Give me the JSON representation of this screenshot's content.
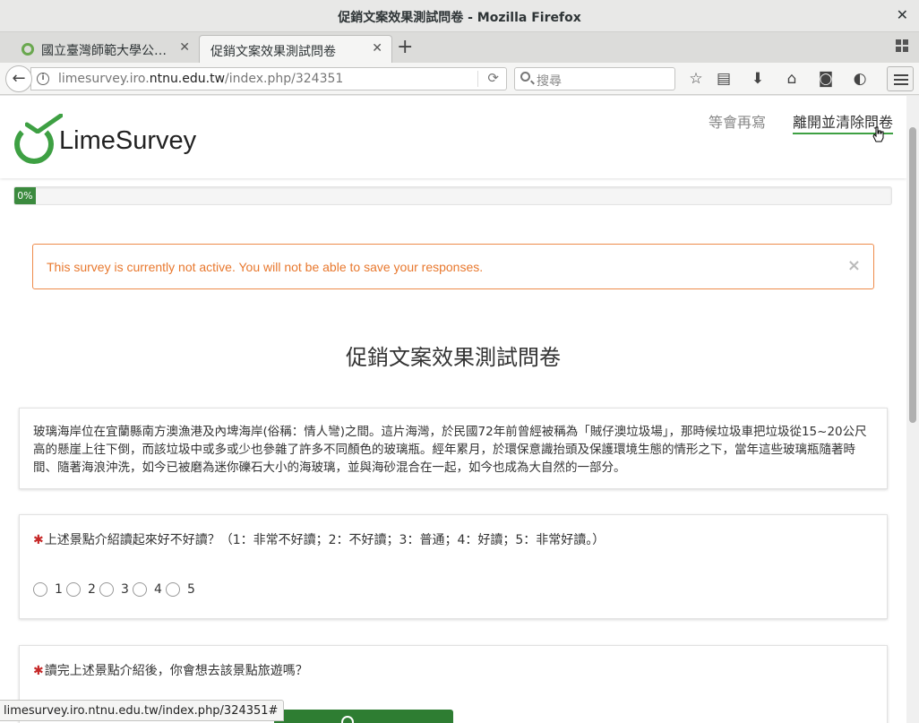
{
  "window": {
    "title": "促銷文案效果測試問卷 - Mozilla Firefox"
  },
  "tabs": [
    {
      "label": "國立臺灣師範大學公…"
    },
    {
      "label": "促銷文案效果測試問卷"
    }
  ],
  "navbar": {
    "url_prefix": "limesurvey.iro.",
    "url_domain": "ntnu.edu.tw",
    "url_suffix": "/index.php/324351",
    "search_placeholder": "搜尋"
  },
  "header": {
    "logo_text": "LimeSurvey",
    "resume_later": "等會再寫",
    "exit_clear": "離開並清除問卷"
  },
  "progress": {
    "label": "0%",
    "value": 0
  },
  "alert": {
    "message": "This survey is currently not active. You will not be able to save your responses."
  },
  "survey": {
    "title": "促銷文案效果測試問卷",
    "intro": "玻璃海岸位在宜蘭縣南方澳漁港及內埤海岸(俗稱：情人彎)之間。這片海灣，於民國72年前曾經被稱為「賊仔澳垃圾場」，那時候垃圾車把垃圾從15~20公尺高的懸崖上往下倒，而該垃圾中或多或少也參雜了許多不同顏色的玻璃瓶。經年累月，於環保意識抬頭及保護環境生態的情形之下，當年這些玻璃瓶隨著時間、隨著海浪沖洗，如今已被磨為迷你礫石大小的海玻璃，並與海砂混合在一起，如今也成為大自然的一部分。",
    "q1": {
      "required_mark": "✱",
      "text": "上述景點介紹讀起來好不好讀？（1：非常不好讀；2：不好讀；3：普通；4：好讀；5：非常好讀。）",
      "options": [
        "1",
        "2",
        "3",
        "4",
        "5"
      ]
    },
    "q2": {
      "required_mark": "✱",
      "text": "讀完上述景點介紹後，你會想去該景點旅遊嗎？"
    }
  },
  "statusbar": {
    "text": "limesurvey.iro.ntnu.edu.tw/index.php/324351#"
  },
  "colors": {
    "brand_green": "#3ea043",
    "alert_orange": "#e8782e",
    "required_red": "#c62828"
  }
}
